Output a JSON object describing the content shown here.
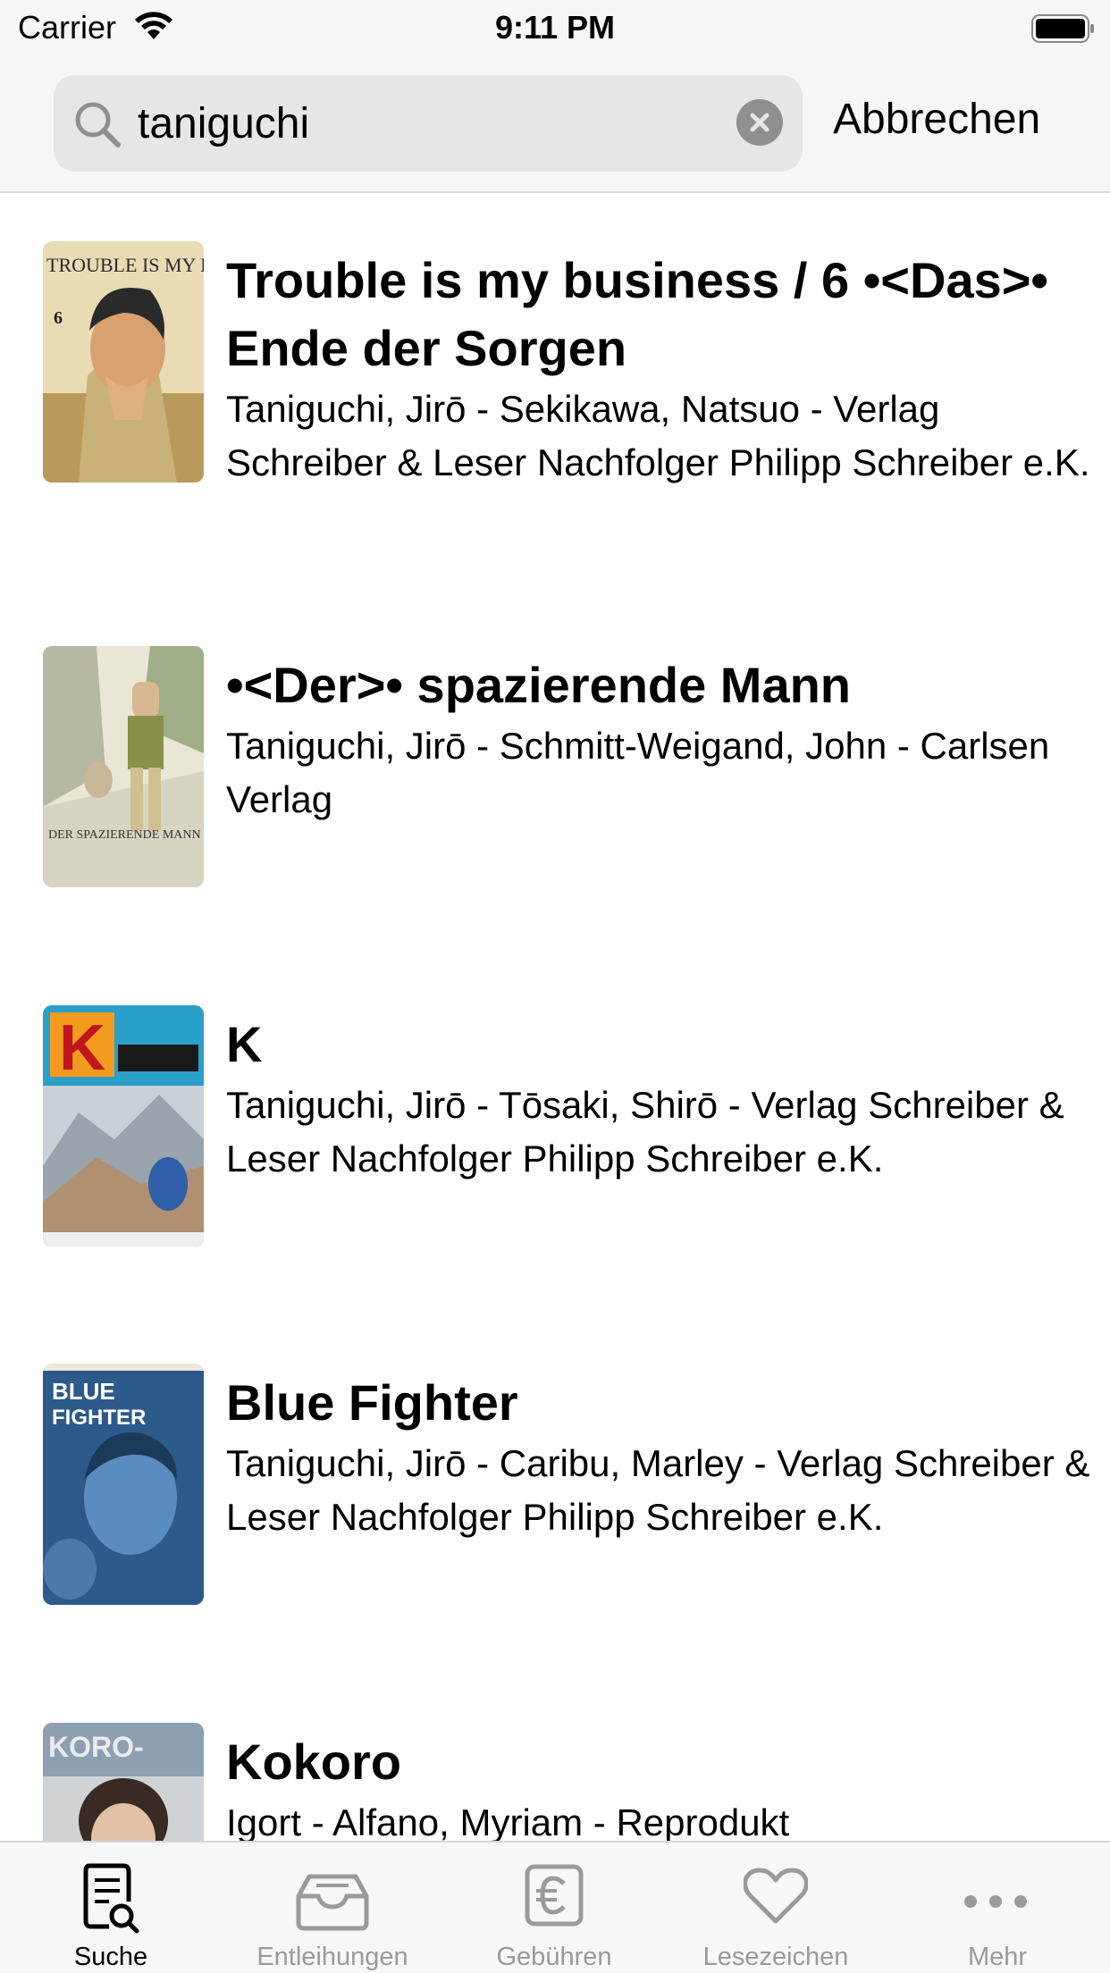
{
  "status_bar": {
    "carrier": "Carrier",
    "time": "9:11 PM"
  },
  "search": {
    "value": "taniguchi",
    "cancel_label": "Abbrechen"
  },
  "results": [
    {
      "title": "Trouble is my business / 6 •<Das>• Ende der Sorgen",
      "meta": "Taniguchi, Jirō - Sekikawa, Natsuo - Verlag Schreiber & Leser Nachfolger Philipp Schreiber e.K.",
      "cover_text": "TROUBLE IS MY BUSINESS"
    },
    {
      "title": "•<Der>• spazierende Mann",
      "meta": "Taniguchi, Jirō - Schmitt-Weigand, John - Carlsen Verlag",
      "cover_text": "DER SPAZIERENDE MANN"
    },
    {
      "title": "K",
      "meta": "Taniguchi, Jirō - Tōsaki, Shirō - Verlag Schreiber & Leser Nachfolger Philipp Schreiber e.K.",
      "cover_text": "K"
    },
    {
      "title": "Blue Fighter",
      "meta": "Taniguchi, Jirō - Caribu, Marley - Verlag Schreiber & Leser Nachfolger Philipp Schreiber e.K.",
      "cover_text": "BLUE FIGHTER"
    },
    {
      "title": "Kokoro",
      "meta": "Igort - Alfano, Myriam - Reprodukt",
      "cover_text": "KOKORO"
    }
  ],
  "tabs": [
    {
      "label": "Suche",
      "icon": "search-document-icon",
      "active": true
    },
    {
      "label": "Entleihungen",
      "icon": "tray-icon",
      "active": false
    },
    {
      "label": "Gebühren",
      "icon": "euro-icon",
      "active": false
    },
    {
      "label": "Lesezeichen",
      "icon": "heart-icon",
      "active": false
    },
    {
      "label": "Mehr",
      "icon": "more-icon",
      "active": false
    }
  ],
  "colors": {
    "active_tab": "#000000",
    "inactive_tab": "#9a9a9a",
    "header_bg": "#f6f6f6"
  }
}
